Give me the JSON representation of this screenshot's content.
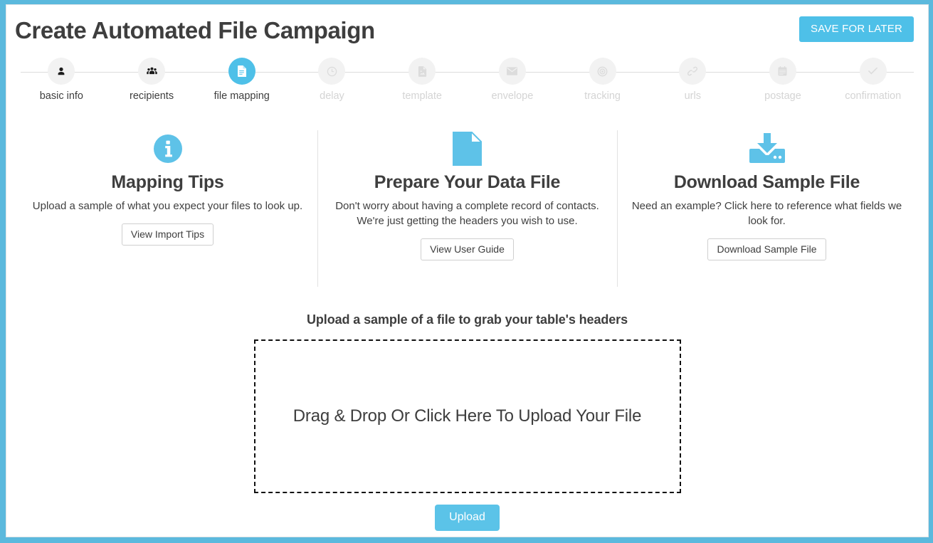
{
  "header": {
    "title": "Create Automated File Campaign",
    "save_label": "SAVE FOR LATER"
  },
  "colors": {
    "accent": "#4ec0e8",
    "frame": "#5bb9dd",
    "icon_blue": "#5ec2e8",
    "pending_gray": "#d4d4d4",
    "text": "#3e3e3e"
  },
  "stepper": {
    "steps": [
      {
        "label": "basic info",
        "icon": "user-icon",
        "state": "done"
      },
      {
        "label": "recipients",
        "icon": "users-group-icon",
        "state": "done"
      },
      {
        "label": "file mapping",
        "icon": "file-document-icon",
        "state": "active"
      },
      {
        "label": "delay",
        "icon": "clock-icon",
        "state": "pending"
      },
      {
        "label": "template",
        "icon": "image-file-icon",
        "state": "pending"
      },
      {
        "label": "envelope",
        "icon": "envelope-icon",
        "state": "pending"
      },
      {
        "label": "tracking",
        "icon": "target-icon",
        "state": "pending"
      },
      {
        "label": "urls",
        "icon": "link-icon",
        "state": "pending"
      },
      {
        "label": "postage",
        "icon": "calendar-icon",
        "state": "pending"
      },
      {
        "label": "confirmation",
        "icon": "check-icon",
        "state": "pending"
      }
    ]
  },
  "info_columns": [
    {
      "icon": "info-circle-icon",
      "title": "Mapping Tips",
      "description": "Upload a sample of what you expect your files to look up.",
      "button_label": "View Import Tips"
    },
    {
      "icon": "blank-document-icon",
      "title": "Prepare Your Data File",
      "description": "Don't worry about having a complete record of contacts. We're just getting the headers you wish to use.",
      "button_label": "View User Guide"
    },
    {
      "icon": "download-tray-icon",
      "title": "Download Sample File",
      "description": "Need an example? Click here to reference what fields we look for.",
      "button_label": "Download Sample File"
    }
  ],
  "upload": {
    "heading": "Upload a sample of a file to grab your table's headers",
    "dropzone_text": "Drag & Drop Or Click Here To Upload Your File",
    "button_label": "Upload"
  }
}
